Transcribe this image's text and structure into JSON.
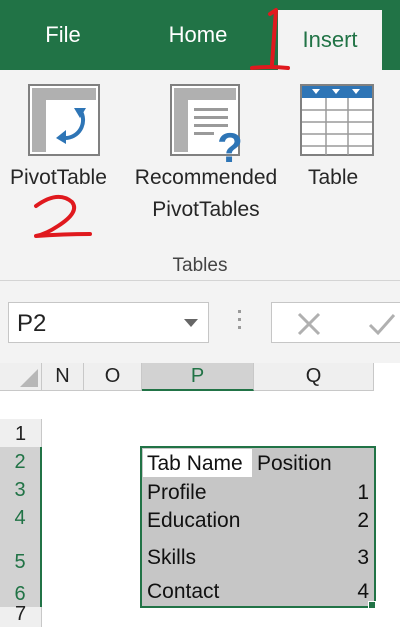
{
  "tabs": {
    "file": "File",
    "home": "Home",
    "insert": "Insert"
  },
  "ribbon": {
    "pivottable_label": "PivotTable",
    "recommended_line1": "Recommended",
    "recommended_line2": "PivotTables",
    "table_label": "Table",
    "group_label": "Tables"
  },
  "annotations": {
    "step1": "1",
    "step2": "2",
    "color": "#e0191e"
  },
  "formula_bar": {
    "name_box": "P2"
  },
  "grid": {
    "columns": [
      "N",
      "O",
      "P",
      "Q"
    ],
    "rows": [
      "1",
      "2",
      "3",
      "4",
      "5",
      "6",
      "7"
    ],
    "selected_column": "P",
    "table": {
      "headers": [
        "Tab Name",
        "Position"
      ],
      "rows": [
        {
          "name": "Profile",
          "position": "1"
        },
        {
          "name": "Education",
          "position": "2"
        },
        {
          "name": "Skills",
          "position": "3"
        },
        {
          "name": "Contact",
          "position": "4"
        }
      ]
    }
  },
  "colors": {
    "accent": "#217346",
    "ribbon_bg": "#f3f3f3",
    "selection_fill": "#c6c6c6"
  }
}
